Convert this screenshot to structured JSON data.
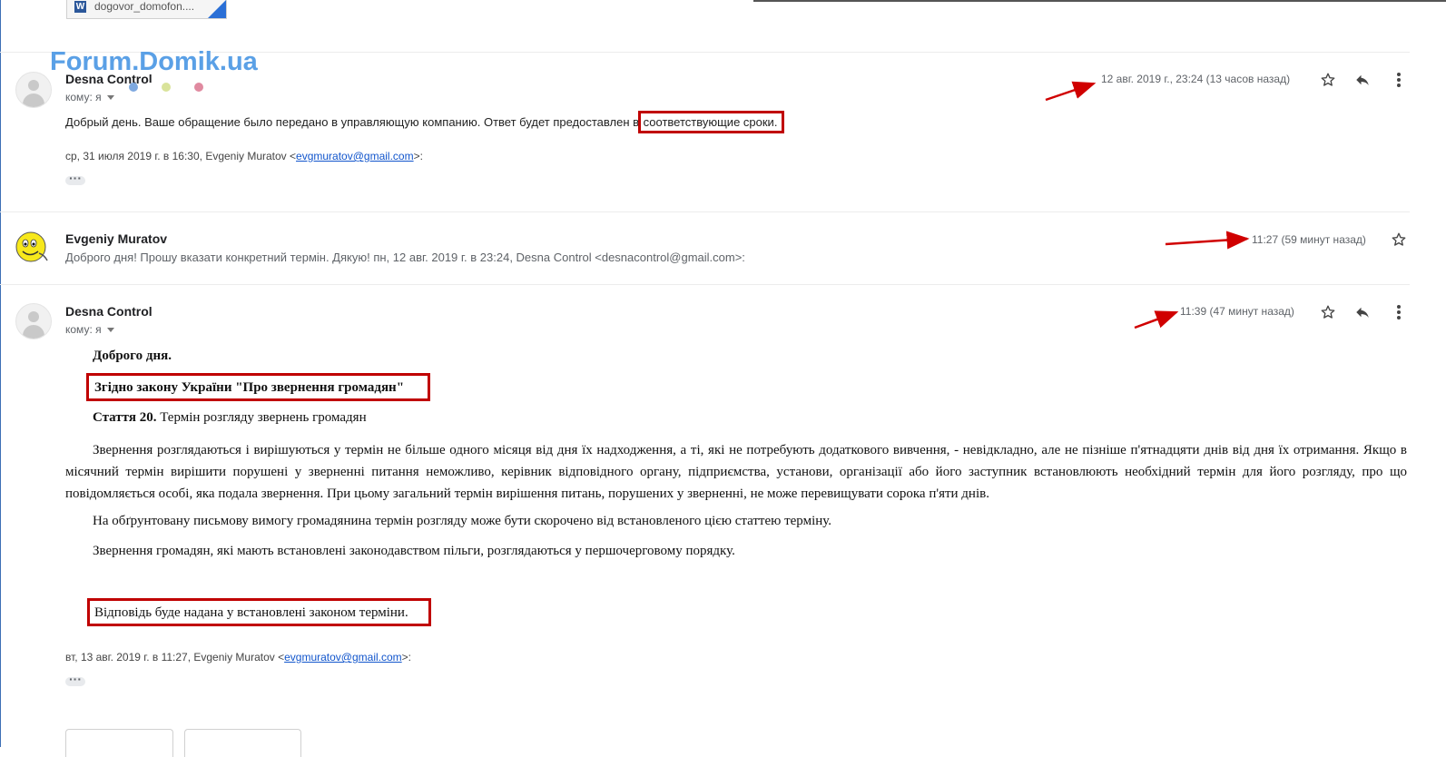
{
  "attachment": {
    "name": "dogovor_domofon...."
  },
  "watermark": "Forum.Domik.ua",
  "colors": {
    "accent": "#1155cc",
    "annotation_red": "#c00000",
    "watermark": "#5aa0e6"
  },
  "messages": [
    {
      "sender": "Desna Control",
      "to": "кому: я",
      "time": "12 авг. 2019 г., 23:24 (13 часов назад)",
      "text_before": "Добрый день. Ваше обращение было передано в управляющую компанию. Ответ будет предоставлен в ",
      "text_highlight": "соответствующие сроки.",
      "quote_prefix": "ср, 31 июля 2019 г. в 16:30, Evgeniy Muratov <",
      "quote_email": "evgmuratov@gmail.com",
      "quote_suffix": ">:"
    },
    {
      "sender": "Evgeniy Muratov",
      "time": "11:27 (59 минут назад)",
      "snippet": "Доброго дня! Прошу вказати конкретний термін. Дякую! пн, 12 авг. 2019 г. в 23:24, Desna Control <desnacontrol@gmail.com>:"
    },
    {
      "sender": "Desna Control",
      "to": "кому: я",
      "time": "11:39 (47 минут назад)",
      "greeting": "Доброго дня.",
      "law_title": "Згідно закону України \"Про звернення громадян\"",
      "article_bold": "Стаття 20.",
      "article_title": " Термін розгляду звернень громадян",
      "para1": "Звернення розглядаються і вирішуються у термін не більше одного місяця від дня їх надходження, а ті, які не потребують додаткового вивчення, - невідкладно, але не пізніше п'ятнадцяти днів від дня їх отримання. Якщо в місячний термін вирішити порушені у зверненні питання неможливо, керівник відповідного органу, підприємства, установи, організації або його заступник встановлюють необхідний термін для його розгляду, про що повідомляється особі, яка подала звернення. При цьому загальний термін вирішення питань, порушених у зверненні, не може перевищувати сорока п'яти днів.",
      "para2": "На обґрунтовану письмову вимогу громадянина термін розгляду може бути скорочено від встановленого цією статтею терміну.",
      "para3": "Звернення громадян, які мають встановлені законодавством пільги, розглядаються у першочерговому порядку.",
      "answer": "Відповідь буде надана у встановлені законом терміни.",
      "quote_prefix": "вт, 13 авг. 2019 г. в 11:27, Evgeniy Muratov <",
      "quote_email": "evgmuratov@gmail.com",
      "quote_suffix": ">:"
    }
  ],
  "icons": {
    "star": "star-icon",
    "reply": "reply-icon",
    "more": "more-vert-icon"
  }
}
